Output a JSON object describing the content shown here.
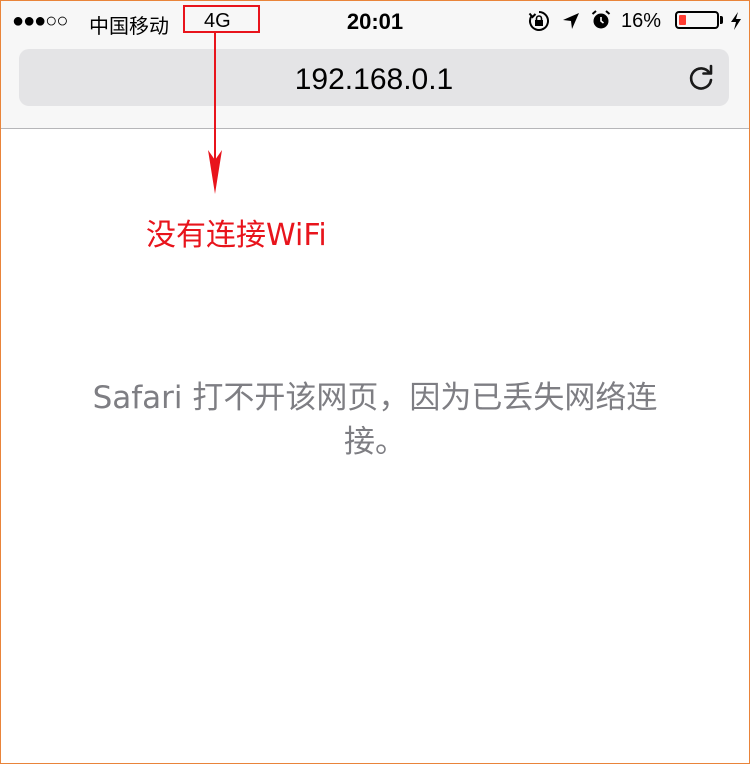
{
  "status_bar": {
    "signal": "●●●○○",
    "carrier": "中国移动",
    "network": "4G",
    "time": "20:01",
    "battery_percent": "16%",
    "battery_level": 0.16,
    "battery_color": "#ff3b30",
    "icons": [
      "orientation-lock-icon",
      "location-icon",
      "alarm-icon",
      "battery-icon",
      "charging-icon"
    ]
  },
  "browser": {
    "url": "192.168.0.1",
    "reload_icon": "reload-icon"
  },
  "annotation": {
    "label": "没有连接WiFi",
    "color": "#e8141c"
  },
  "page": {
    "error_message": "Safari 打不开该网页，因为已丢失网络连接。"
  }
}
